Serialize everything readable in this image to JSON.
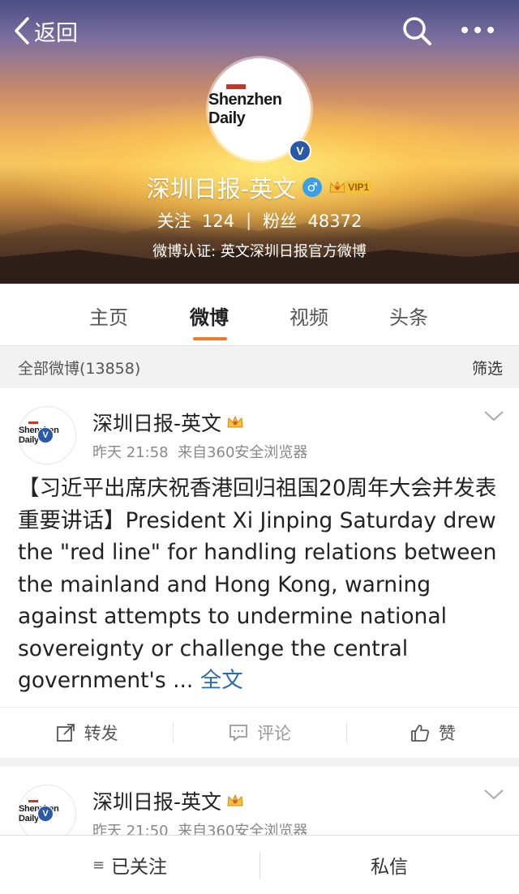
{
  "header": {
    "back_label": "返回",
    "back_icon": "chevron-left-icon",
    "search_icon": "search-icon",
    "more_icon": "more-dots-icon"
  },
  "profile": {
    "logo_text": "Shenzhen Daily",
    "verified_mark": "V",
    "name": "深圳日报-英文",
    "gender_symbol": "♂",
    "vip_label": "VIP1",
    "following_label": "关注",
    "following_count": "124",
    "separator": "|",
    "followers_label": "粉丝",
    "followers_count": "48372",
    "verification": "微博认证: 英文深圳日报官方微博"
  },
  "tabs": [
    {
      "label": "主页"
    },
    {
      "label": "微博",
      "active": true
    },
    {
      "label": "视频"
    },
    {
      "label": "头条"
    }
  ],
  "filter": {
    "all_posts_label": "全部微博(13858)",
    "filter_label": "筛选"
  },
  "posts": [
    {
      "author": "深圳日报-英文",
      "time": "昨天 21:58",
      "source": "来自360安全浏览器",
      "text": "【习近平出席庆祝香港回归祖国20周年大会并发表重要讲话】President Xi Jinping Saturday drew the \"red line\" for handling relations between the mainland and Hong Kong, warning against attempts to undermine national sovereignty or challenge the central government's ...",
      "more_label": "全文",
      "actions": {
        "repost": "转发",
        "comment": "评论",
        "like": "赞"
      }
    },
    {
      "author": "深圳日报-英文",
      "time": "昨天 21:50",
      "source": "来自360安全浏览器"
    }
  ],
  "bottom_bar": {
    "menu_icon": "≡",
    "followed_label": "已关注",
    "message_label": "私信"
  },
  "colors": {
    "accent": "#f07a2a",
    "link": "#2a6bb0",
    "verified": "#2a5aa6"
  }
}
